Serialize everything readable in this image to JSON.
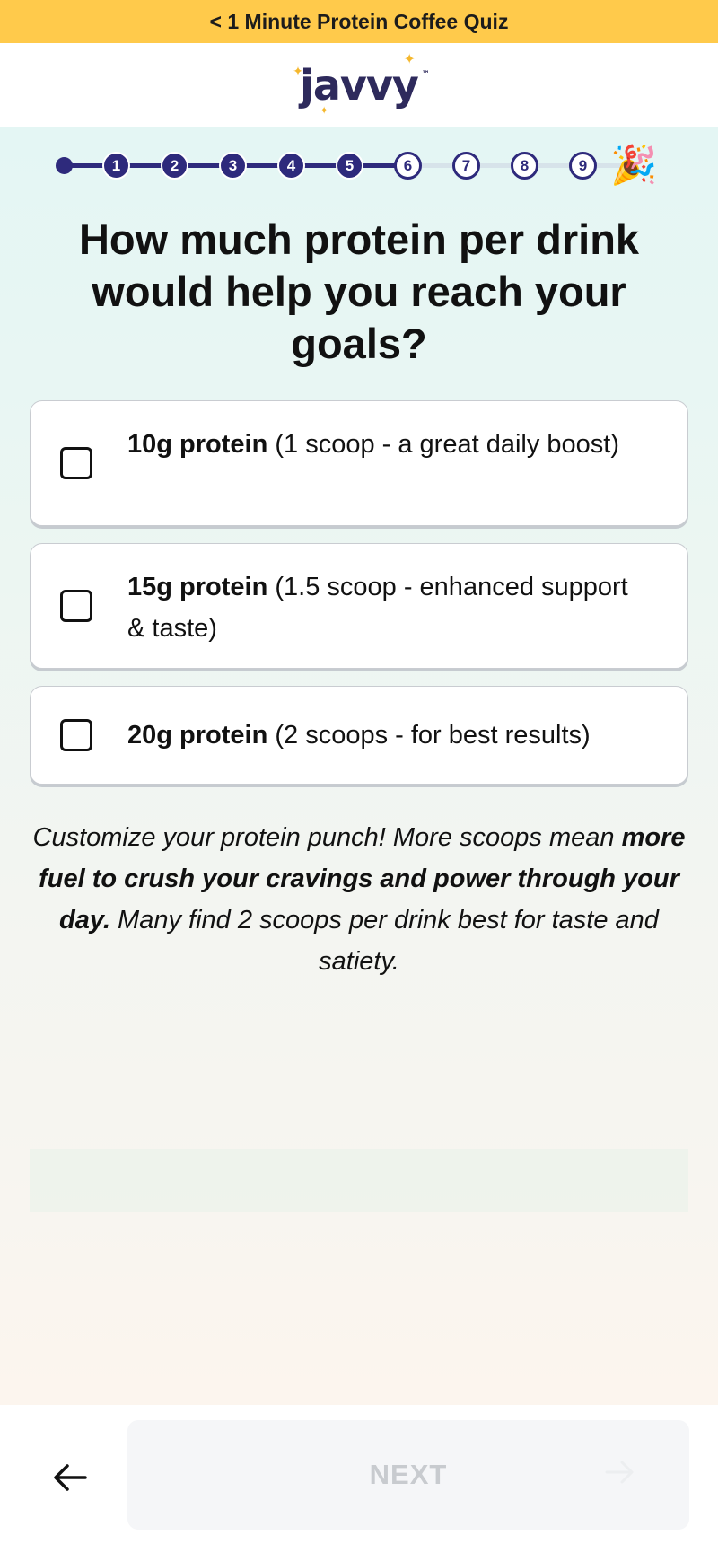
{
  "banner": {
    "text": "< 1 Minute Protein Coffee Quiz"
  },
  "logo": {
    "text": "javvy",
    "tm": "™"
  },
  "progress": {
    "steps": [
      "1",
      "2",
      "3",
      "4",
      "5",
      "6",
      "7",
      "8",
      "9"
    ],
    "completed_count": 5,
    "total_steps": 9,
    "final_icon": "party-popper-icon",
    "active_color": "#2e2a7c",
    "inactive_color": "#d7e3ea"
  },
  "question": "How much protein per drink would help you reach your goals?",
  "options": [
    {
      "bold": "10g protein",
      "rest": " (1 scoop - a great daily boost)",
      "checked": false
    },
    {
      "bold": "15g protein",
      "rest": " (1.5 scoop - enhanced support & taste)",
      "checked": false
    },
    {
      "bold": "20g protein",
      "rest": " (2 scoops - for best results)",
      "checked": false
    }
  ],
  "description": {
    "part1": "Customize your protein punch! More scoops mean ",
    "bold": "more fuel to crush your cravings and power through your day.",
    "part2": " Many find 2 scoops per drink best for taste and satiety."
  },
  "footer": {
    "back_icon": "arrow-left-icon",
    "next_label": "NEXT",
    "next_icon": "arrow-right-icon",
    "next_enabled": false
  },
  "colors": {
    "banner": "#ffca4b",
    "brand": "#2e2a5c",
    "accent_star": "#f5b82e"
  }
}
